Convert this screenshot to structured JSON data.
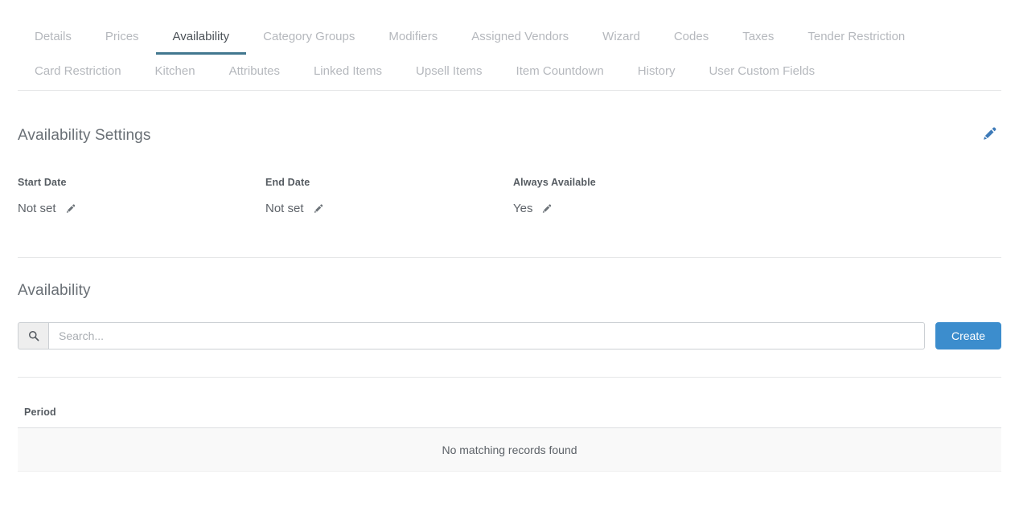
{
  "tabs": {
    "row1": [
      {
        "label": "Details",
        "active": false
      },
      {
        "label": "Prices",
        "active": false
      },
      {
        "label": "Availability",
        "active": true
      },
      {
        "label": "Category Groups",
        "active": false
      },
      {
        "label": "Modifiers",
        "active": false
      },
      {
        "label": "Assigned Vendors",
        "active": false
      },
      {
        "label": "Wizard",
        "active": false
      },
      {
        "label": "Codes",
        "active": false
      },
      {
        "label": "Taxes",
        "active": false
      },
      {
        "label": "Tender Restriction",
        "active": false
      }
    ],
    "row2": [
      {
        "label": "Card Restriction",
        "active": false
      },
      {
        "label": "Kitchen",
        "active": false
      },
      {
        "label": "Attributes",
        "active": false
      },
      {
        "label": "Linked Items",
        "active": false
      },
      {
        "label": "Upsell Items",
        "active": false
      },
      {
        "label": "Item Countdown",
        "active": false
      },
      {
        "label": "History",
        "active": false
      },
      {
        "label": "User Custom Fields",
        "active": false
      }
    ]
  },
  "settings_section": {
    "title": "Availability Settings",
    "edit_icon": "pencil-icon",
    "fields": [
      {
        "label": "Start Date",
        "value": "Not set",
        "edit_icon": "pencil-icon"
      },
      {
        "label": "End Date",
        "value": "Not set",
        "edit_icon": "pencil-icon"
      },
      {
        "label": "Always Available",
        "value": "Yes",
        "edit_icon": "pencil-icon"
      }
    ]
  },
  "availability_section": {
    "title": "Availability",
    "search": {
      "icon": "search-icon",
      "placeholder": "Search...",
      "value": ""
    },
    "create_label": "Create",
    "table": {
      "columns": [
        "Period"
      ],
      "empty_message": "No matching records found"
    }
  },
  "colors": {
    "active_tab_underline": "#42778f",
    "active_tab_text": "#4b5157",
    "inactive_tab_text": "#b5b8bd",
    "edit_icon_blue": "#3d7ab8",
    "create_button": "#3c8dcd",
    "empty_row_bg": "#f9f9f9",
    "divider": "#e6e7e8"
  }
}
